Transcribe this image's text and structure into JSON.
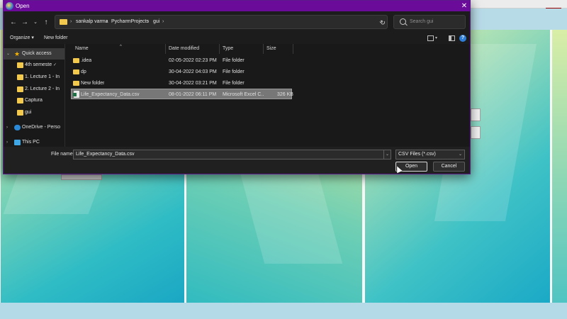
{
  "dialog": {
    "title": "Open",
    "close_glyph": "✕",
    "nav": {
      "back": "←",
      "forward": "→",
      "dropdown": "⌄",
      "up": "↑",
      "refresh": "↻",
      "addr_dropdown": "⌄"
    },
    "breadcrumb": [
      "sankalp varma",
      "PycharmProjects",
      "gui"
    ],
    "breadcrumb_sep": "›",
    "search_placeholder": "Search gui",
    "toolbar": {
      "organize": "Organize ▾",
      "new_folder": "New folder",
      "view_dropdown": "▾",
      "help": "?"
    },
    "sidebar": {
      "items": [
        {
          "label": "Quick access",
          "icon": "star-icon",
          "chevron": "⌄",
          "pinned": false
        },
        {
          "label": "4th semeste",
          "icon": "folder-icon",
          "pinned": true
        },
        {
          "label": "1. Lecture 1 - In",
          "icon": "folder-icon",
          "pinned": false
        },
        {
          "label": "2. Lecture 2 - In",
          "icon": "folder-icon",
          "pinned": false
        },
        {
          "label": "Captura",
          "icon": "folder-icon",
          "pinned": false
        },
        {
          "label": "gui",
          "icon": "folder-icon",
          "pinned": false
        },
        {
          "label": "OneDrive - Perso",
          "icon": "cloud-icon",
          "chevron": "›",
          "pinned": false
        },
        {
          "label": "This PC",
          "icon": "pc-icon",
          "chevron": "›",
          "pinned": false
        }
      ],
      "pin_glyph": "📌"
    },
    "columns": [
      "Name",
      "Date modified",
      "Type",
      "Size"
    ],
    "sort_arrow": "^",
    "files": [
      {
        "name": ".idea",
        "date": "02-05-2022 02:23 PM",
        "type": "File folder",
        "size": "",
        "kind": "folder",
        "selected": false
      },
      {
        "name": "dp",
        "date": "30-04-2022 04:03 PM",
        "type": "File folder",
        "size": "",
        "kind": "folder",
        "selected": false
      },
      {
        "name": "New folder",
        "date": "30-04-2022 03:21 PM",
        "type": "File folder",
        "size": "",
        "kind": "folder",
        "selected": false
      },
      {
        "name": "Life_Expectancy_Data.csv",
        "date": "08-01-2022 06:11 PM",
        "type": "Microsoft Excel C...",
        "size": "326 KB",
        "kind": "csv",
        "selected": true
      }
    ],
    "file_name_label": "File name:",
    "file_name_value": "Life_Expectancy_Data.csv",
    "file_name_dropdown": "⌄",
    "filter_value": "CSV Files (*.csv)",
    "filter_dropdown": "⌄",
    "open_label": "Open",
    "cancel_label": "Cancel"
  },
  "background": {
    "close_indicator_color": "#e00000"
  }
}
